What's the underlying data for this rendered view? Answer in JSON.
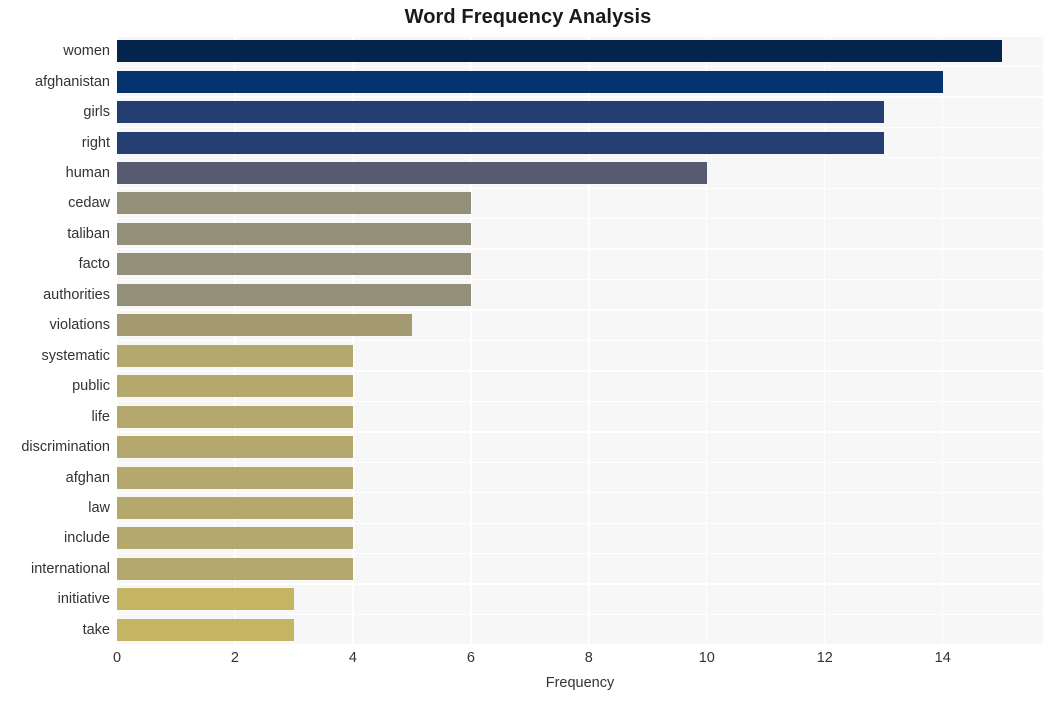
{
  "title": "Word Frequency Analysis",
  "axes": {
    "xlabel": "Frequency",
    "ylabel": "",
    "xticks": [
      "0",
      "2",
      "4",
      "6",
      "8",
      "10",
      "12",
      "14"
    ]
  },
  "colors": {
    "plot_background": "#f7f7f7",
    "figure_background": "#ffffff",
    "gridline": "#ffffff",
    "text": "#333333",
    "title": "#1a1a1a"
  },
  "chart_data": {
    "type": "bar",
    "orientation": "horizontal",
    "title": "Word Frequency Analysis",
    "xlabel": "Frequency",
    "ylabel": "",
    "xlim": [
      0,
      15.7
    ],
    "xticks": [
      0,
      2,
      4,
      6,
      8,
      10,
      12,
      14
    ],
    "grid": true,
    "legend": "none",
    "categories": [
      "women",
      "afghanistan",
      "girls",
      "right",
      "human",
      "cedaw",
      "taliban",
      "facto",
      "authorities",
      "violations",
      "systematic",
      "public",
      "life",
      "discrimination",
      "afghan",
      "law",
      "include",
      "international",
      "initiative",
      "take"
    ],
    "values": [
      15,
      14,
      13,
      13,
      10,
      6,
      6,
      6,
      6,
      5,
      4,
      4,
      4,
      4,
      4,
      4,
      4,
      4,
      3,
      3
    ],
    "bar_colors": [
      "#04244d",
      "#05336f",
      "#253e72",
      "#253f73",
      "#565b72",
      "#938f78",
      "#938f78",
      "#938f78",
      "#938f78",
      "#a39a72",
      "#b5a86c",
      "#b5a86c",
      "#b5a86c",
      "#b5a86c",
      "#b5a86c",
      "#b5a86c",
      "#b5a86c",
      "#b5a86c",
      "#c5b463",
      "#c5b463"
    ]
  }
}
